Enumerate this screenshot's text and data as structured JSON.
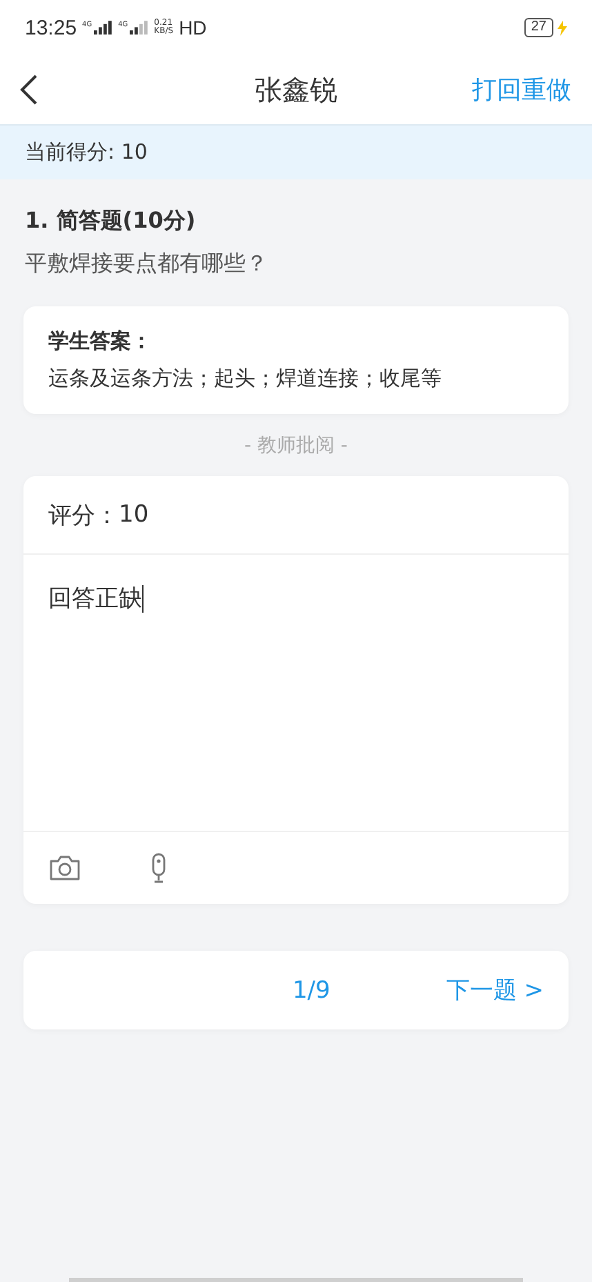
{
  "status_bar": {
    "time": "13:25",
    "network_1": "4G",
    "network_2": "4G",
    "speed_value": "0.21",
    "speed_unit": "KB/S",
    "hd": "HD",
    "battery": "27",
    "charging": true
  },
  "header": {
    "title": "张鑫锐",
    "action": "打回重做"
  },
  "score_banner": "当前得分: 10",
  "question": {
    "title": "1. 简答题(10分)",
    "text": "平敷焊接要点都有哪些？"
  },
  "student_answer": {
    "label": "学生答案：",
    "text": "运条及运条方法；起头；焊道连接；收尾等"
  },
  "review_divider": "- 教师批阅 -",
  "grading": {
    "score_label": "评分：",
    "score": "10",
    "comment": "回答正缺"
  },
  "pager": {
    "position": "1/9",
    "next": "下一题 >"
  }
}
